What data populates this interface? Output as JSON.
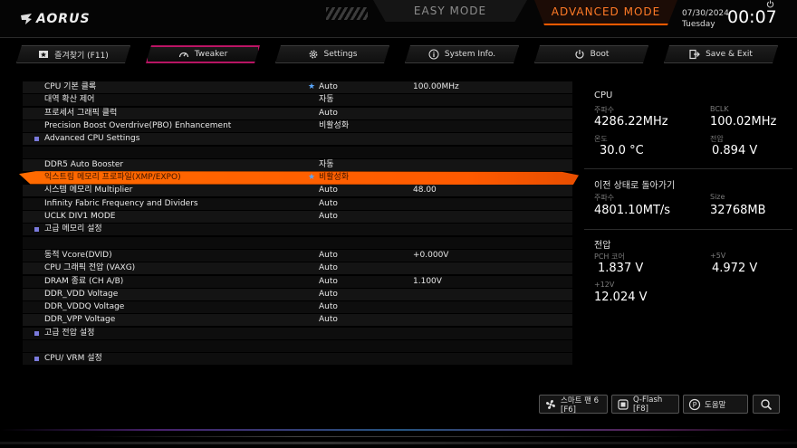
{
  "brand": {
    "logo_text": "AORUS"
  },
  "modes": {
    "easy": "EASY MODE",
    "advanced": "ADVANCED MODE"
  },
  "clock": {
    "date": "07/30/2024",
    "weekday": "Tuesday",
    "time": "00:07"
  },
  "tabs": [
    {
      "label": "즐겨찾기 (F11)",
      "icon": "favorites-icon"
    },
    {
      "label": "Tweaker",
      "icon": "speedometer-icon",
      "active": true
    },
    {
      "label": "Settings",
      "icon": "gear-icon"
    },
    {
      "label": "System Info.",
      "icon": "info-icon"
    },
    {
      "label": "Boot",
      "icon": "power-icon"
    },
    {
      "label": "Save & Exit",
      "icon": "exit-icon"
    }
  ],
  "settings": [
    {
      "label": "CPU 기본 클록",
      "value": "Auto",
      "extra": "100.00MHz",
      "star": "★"
    },
    {
      "label": "대역 확산 제어",
      "value": "자동"
    },
    {
      "label": "프로세서 그래픽 클럭",
      "value": "Auto"
    },
    {
      "label": "Precision Boost Overdrive(PBO) Enhancement",
      "value": "비활성화"
    },
    {
      "label": "Advanced CPU Settings",
      "submenu": true
    },
    {
      "blank": true
    },
    {
      "label": "DDR5 Auto Booster",
      "value": "자동"
    },
    {
      "label": "익스트림 메모리 프로파일(XMP/EXPO)",
      "value": "비활성화",
      "star": "★",
      "highlighted": true
    },
    {
      "label": "시스템 메모리 Multiplier",
      "value": "Auto",
      "extra": "48.00"
    },
    {
      "label": "Infinity Fabric Frequency and Dividers",
      "value": "Auto"
    },
    {
      "label": "UCLK DIV1 MODE",
      "value": "Auto"
    },
    {
      "label": "고급 메모리 설정",
      "submenu": true
    },
    {
      "blank": true
    },
    {
      "label": "동적 Vcore(DVID)",
      "value": "Auto",
      "extra": "+0.000V"
    },
    {
      "label": "CPU 그래픽 전압 (VAXG)",
      "value": "Auto"
    },
    {
      "label": "DRAM 종료 (CH A/B)",
      "value": "Auto",
      "extra": "1.100V"
    },
    {
      "label": "DDR_VDD Voltage",
      "value": "Auto"
    },
    {
      "label": "DDR_VDDQ Voltage",
      "value": "Auto"
    },
    {
      "label": "DDR_VPP Voltage",
      "value": "Auto"
    },
    {
      "label": "고급 전압 설정",
      "submenu": true
    },
    {
      "blank": true
    },
    {
      "label": "CPU/ VRM 설정",
      "submenu": true
    }
  ],
  "info": {
    "cpu": {
      "title": "CPU",
      "freq_label": "주파수",
      "freq": "4286.22MHz",
      "bclk_label": "BCLK",
      "bclk": "100.02MHz",
      "temp_label": "온도",
      "temp": "30.0 °C",
      "volt_label": "전압",
      "volt": "0.894 V"
    },
    "memory": {
      "title": "이전 상태로 돌아가기",
      "freq_label": "주파수",
      "freq": "4801.10MT/s",
      "size_label": "Size",
      "size": "32768MB"
    },
    "voltage": {
      "title": "전압",
      "pch_label": "PCH 코어",
      "pch": "1.837 V",
      "v5_label": "+5V",
      "v5": "4.972 V",
      "v12_label": "+12V",
      "v12": "12.024 V"
    }
  },
  "bottom_buttons": {
    "smart_fan": "스마트 팬 6 [F6]",
    "qflash": "Q-Flash [F8]",
    "help": "도움말"
  },
  "colors": {
    "accent_orange": "#ff5a00",
    "tab_active_border": "#c01466",
    "submenu_bullet": "#7a7adc",
    "star": "#5aa8ff"
  }
}
